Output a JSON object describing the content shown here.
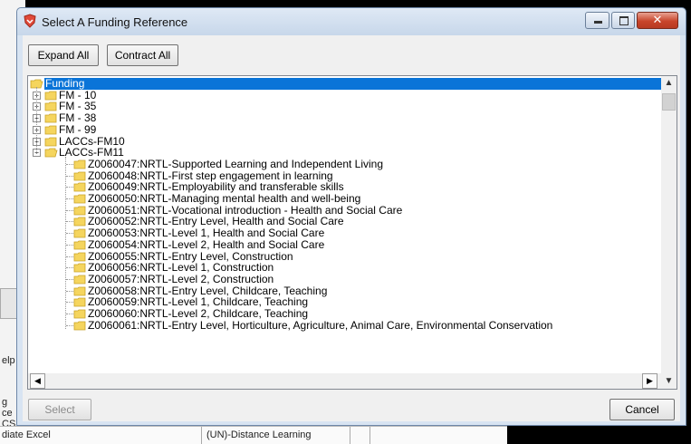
{
  "dialog": {
    "title": "Select A Funding Reference",
    "expand_all": "Expand All",
    "contract_all": "Contract All",
    "select": "Select",
    "cancel": "Cancel"
  },
  "tree": {
    "root": "Funding",
    "folders": [
      "FM - 10",
      "FM - 35",
      "FM - 38",
      "FM - 99",
      "LACCs-FM10",
      "LACCs-FM11"
    ],
    "children": [
      "Z0060047:NRTL-Supported Learning and Independent Living",
      "Z0060048:NRTL-First step engagement in learning",
      "Z0060049:NRTL-Employability and transferable skills",
      "Z0060050:NRTL-Managing mental health and well-being",
      "Z0060051:NRTL-Vocational introduction - Health and Social Care",
      "Z0060052:NRTL-Entry Level, Health and Social Care",
      "Z0060053:NRTL-Level 1, Health and Social Care",
      "Z0060054:NRTL-Level 2, Health and Social Care",
      "Z0060055:NRTL-Entry Level, Construction",
      "Z0060056:NRTL-Level 1, Construction",
      "Z0060057:NRTL-Level 2, Construction",
      "Z0060058:NRTL-Entry Level, Childcare, Teaching",
      "Z0060059:NRTL-Level 1, Childcare, Teaching",
      "Z0060060:NRTL-Level 2, Childcare, Teaching",
      "Z0060061:NRTL-Entry Level, Horticulture, Agriculture, Animal Care, Environmental Conservation"
    ]
  },
  "background": {
    "left_fragments": [
      "elp",
      "g",
      "ce",
      "CS"
    ],
    "bottom_left": "diate Excel",
    "bottom_mid": "(UN)-Distance Learning"
  },
  "colors": {
    "selection": "#0a74d8",
    "folder": "#f5d55e",
    "close_button": "#c8452b"
  }
}
